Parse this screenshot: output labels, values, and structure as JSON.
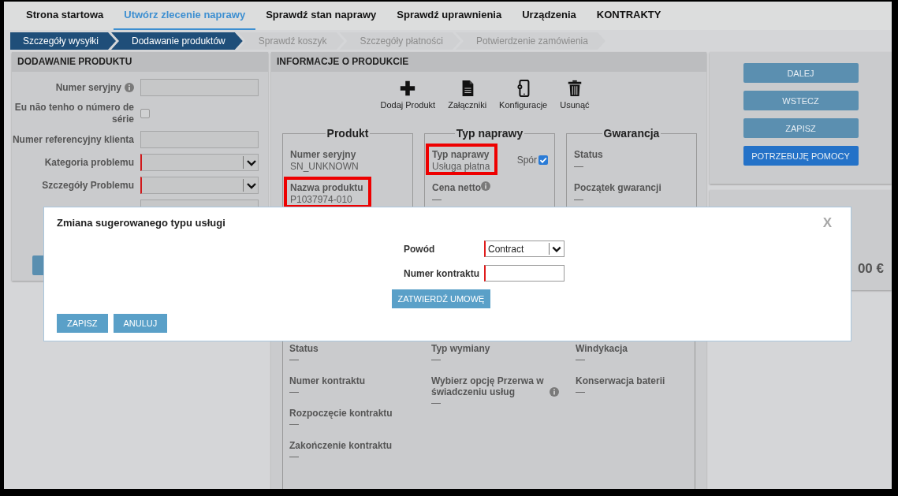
{
  "nav": {
    "tabs": [
      {
        "label": "Strona startowa",
        "selected": false
      },
      {
        "label": "Utwórz zlecenie naprawy",
        "selected": true
      },
      {
        "label": "Sprawdź stan naprawy",
        "selected": false
      },
      {
        "label": "Sprawdź uprawnienia",
        "selected": false
      },
      {
        "label": "Urządzenia",
        "selected": false
      },
      {
        "label": "KONTRAKTY",
        "selected": false
      }
    ]
  },
  "steps": [
    {
      "label": "Szczegóły wysyłki",
      "completed": true
    },
    {
      "label": "Dodawanie produktów",
      "completed": true
    },
    {
      "label": "Sprawdź koszyk",
      "completed": false
    },
    {
      "label": "Szczegóły płatności",
      "completed": false
    },
    {
      "label": "Potwierdzenie zamówienia",
      "completed": false
    }
  ],
  "add_product": {
    "title": "DODAWANIE PRODUKTU",
    "fields": [
      {
        "kind": "input",
        "label": "Numer seryjny",
        "info": true,
        "required": false
      },
      {
        "kind": "checkbox",
        "label": "Eu não tenho o número de série",
        "checked": false
      },
      {
        "kind": "input",
        "label": "Numer referencyjny klienta",
        "required": false
      },
      {
        "kind": "select",
        "label": "Kategoria problemu",
        "required": true
      },
      {
        "kind": "select",
        "label": "Szczegóły Problemu",
        "required": true
      },
      {
        "kind": "input",
        "required": false
      }
    ]
  },
  "product_info": {
    "title": "INFORMACJE O PRODUKCIE",
    "actions": [
      {
        "label": "Dodaj Produkt",
        "kind": "add"
      },
      {
        "label": "Załączniki",
        "kind": "attachments"
      },
      {
        "label": "Konfiguracje",
        "kind": "configuration"
      },
      {
        "label": "Usunąć",
        "kind": "delete"
      }
    ],
    "sections": [
      {
        "legend": "Produkt",
        "fields": [
          {
            "label": "Numer seryjny",
            "value": "SN_UNKNOWN",
            "highlighted": false
          },
          {
            "label": "Nazwa produktu",
            "value": "P1037974-010",
            "highlighted": true
          }
        ]
      },
      {
        "legend": "Typ naprawy",
        "dispute": {
          "label": "Spór",
          "checked": true
        },
        "fields": [
          {
            "label": "Typ naprawy",
            "value": "Usługa płatna",
            "highlighted": true
          },
          {
            "label": "Cena netto",
            "value": "—",
            "info": true,
            "highlighted": false
          }
        ]
      },
      {
        "legend": "Gwarancja",
        "fields": [
          {
            "label": "Status",
            "value": "—",
            "highlighted": false
          },
          {
            "label": "Początek gwarancji",
            "value": "—",
            "highlighted": false
          }
        ]
      }
    ],
    "contract_columns": [
      [
        {
          "label": "Status",
          "value": "—"
        },
        {
          "label": "Numer kontraktu",
          "value": "—"
        },
        {
          "label": "Rozpoczęcie kontraktu",
          "value": "—"
        },
        {
          "label": "Zakończenie kontraktu",
          "value": "—"
        }
      ],
      [
        {
          "label": "Typ wymiany",
          "value": "—"
        },
        {
          "label": "Wybierz opcję Przerwa w świadczeniu usług",
          "value": "—",
          "info": true
        }
      ],
      [
        {
          "label": "Windykacja",
          "value": "—"
        },
        {
          "label": "Konserwacja baterii",
          "value": "—"
        }
      ]
    ]
  },
  "actions_panel": {
    "buttons": [
      {
        "label": "DALEJ",
        "kind": "secondary"
      },
      {
        "label": "WSTECZ",
        "kind": "secondary"
      },
      {
        "label": "ZAPISZ",
        "kind": "secondary"
      },
      {
        "label": "POTRZEBUJĘ POMOCY",
        "kind": "primary"
      }
    ]
  },
  "summary_panel": {
    "total": "00 €"
  },
  "modal": {
    "title": "Zmiana sugerowanego typu usługi",
    "close": "X",
    "fields": [
      {
        "kind": "select",
        "label": "Powód",
        "value": "Contract",
        "required": true
      },
      {
        "kind": "input",
        "label": "Numer kontraktu",
        "required": true
      }
    ],
    "confirm": "ZATWIERDŹ UMOWĘ",
    "buttons": [
      "ZAPISZ",
      "ANULUJ"
    ]
  }
}
